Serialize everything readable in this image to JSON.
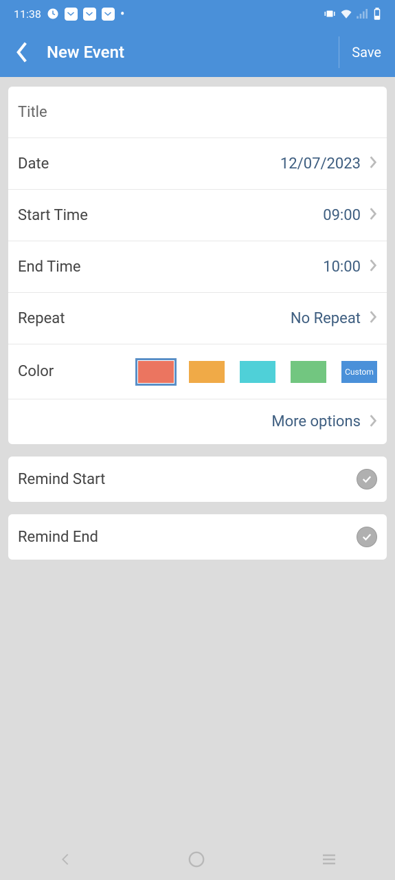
{
  "statusBar": {
    "time": "11:38"
  },
  "header": {
    "title": "New Event",
    "saveLabel": "Save"
  },
  "form": {
    "title": {
      "placeholder": "Title",
      "value": ""
    },
    "date": {
      "label": "Date",
      "value": "12/07/2023"
    },
    "startTime": {
      "label": "Start Time",
      "value": "09:00"
    },
    "endTime": {
      "label": "End Time",
      "value": "10:00"
    },
    "repeat": {
      "label": "Repeat",
      "value": "No Repeat"
    },
    "color": {
      "label": "Color",
      "customLabel": "Custom",
      "swatches": [
        {
          "hex": "#eb7560",
          "selected": true
        },
        {
          "hex": "#f0aa47",
          "selected": false
        },
        {
          "hex": "#4fd0d8",
          "selected": false
        },
        {
          "hex": "#72c680",
          "selected": false
        }
      ]
    },
    "moreOptions": "More options"
  },
  "reminders": {
    "start": {
      "label": "Remind Start",
      "checked": true
    },
    "end": {
      "label": "Remind End",
      "checked": true
    }
  }
}
